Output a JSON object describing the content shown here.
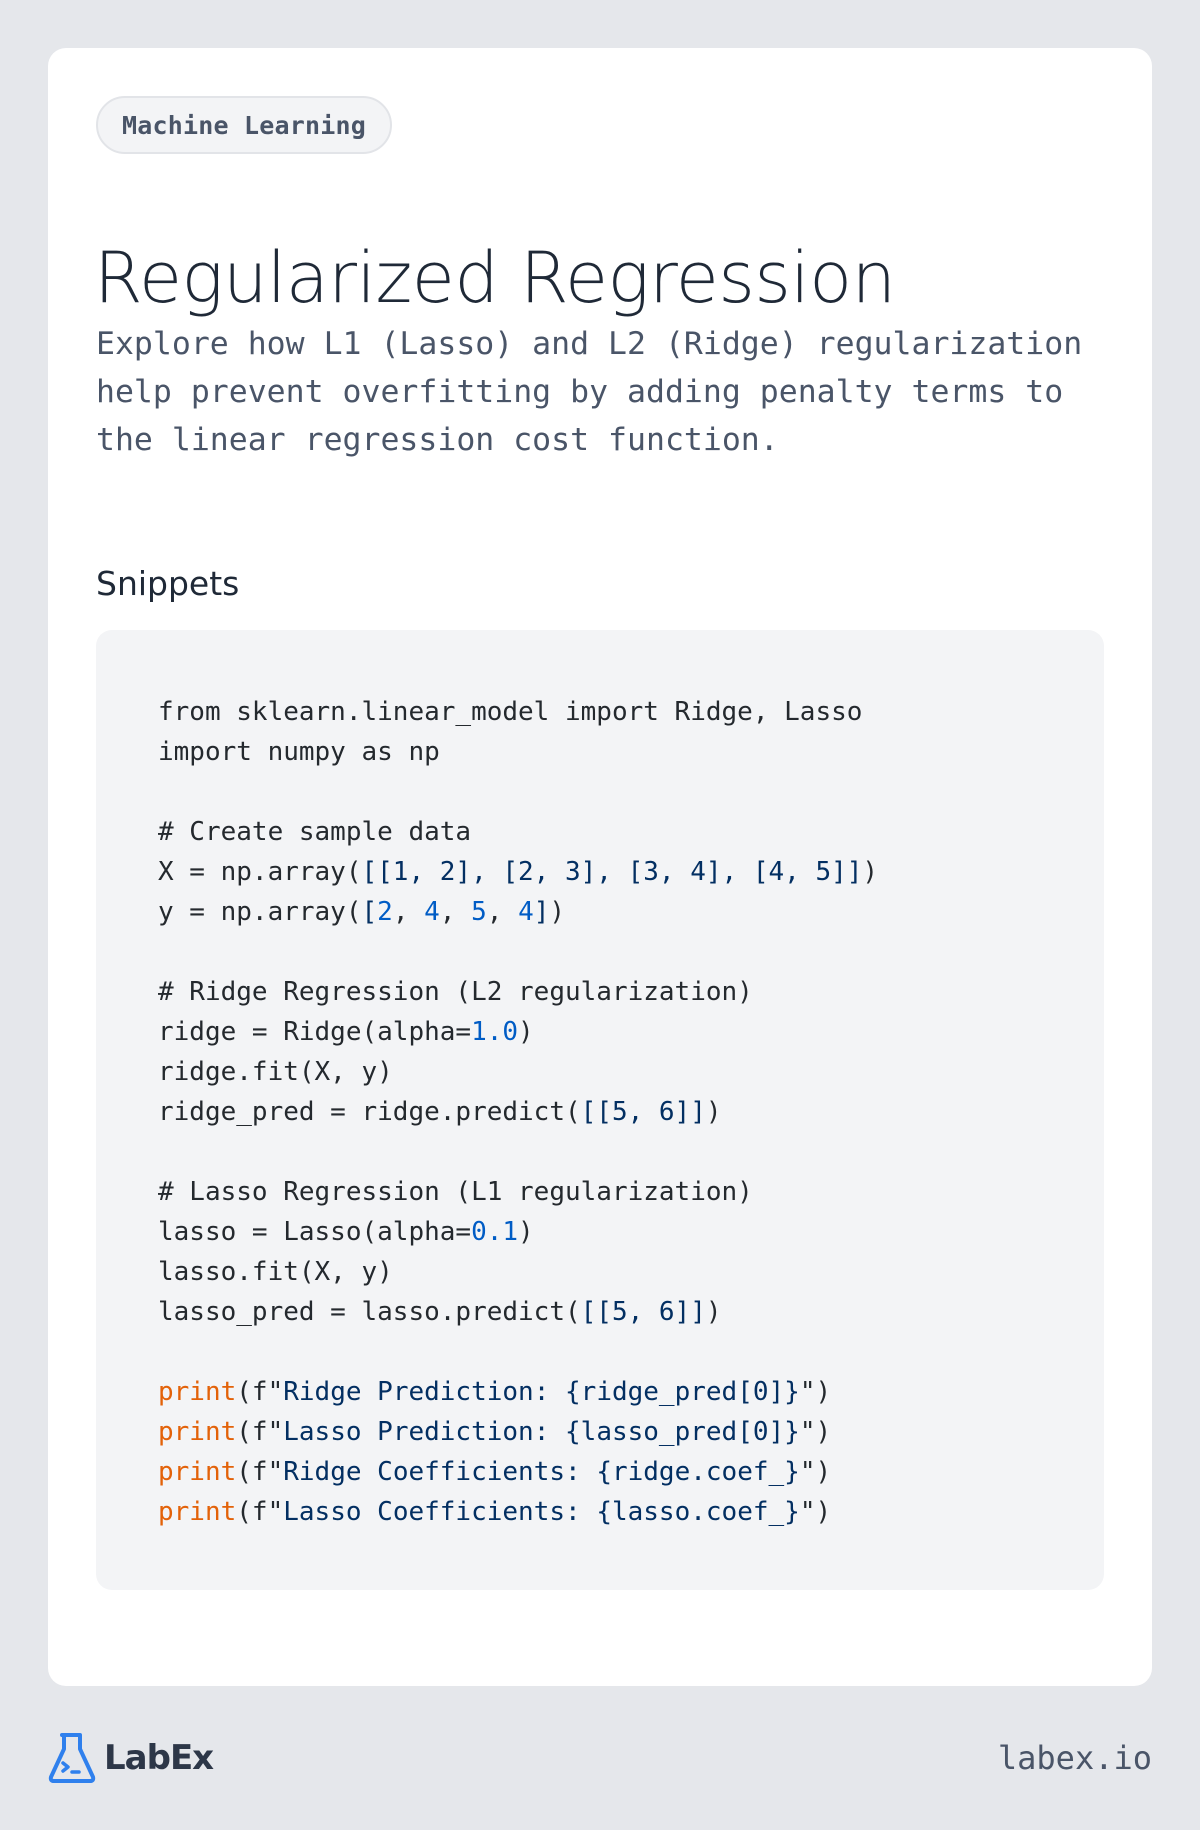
{
  "badge": {
    "label": "Machine Learning"
  },
  "page": {
    "title": "Regularized Regression",
    "description": "Explore how L1 (Lasso) and L2 (Ridge) regularization help prevent overfitting by adding penalty terms to the linear regression cost function."
  },
  "snippets": {
    "heading": "Snippets",
    "language": "python",
    "lines": [
      [
        {
          "t": "from sklearn.linear_model import Ridge, Lasso",
          "c": "plain"
        }
      ],
      [
        {
          "t": "import numpy as np",
          "c": "plain"
        }
      ],
      [],
      [
        {
          "t": "# Create sample data",
          "c": "plain"
        }
      ],
      [
        {
          "t": "X = np.array(",
          "c": "plain"
        },
        {
          "t": "[[1, 2], [2, 3], [3, 4], [4, 5]]",
          "c": "navy"
        },
        {
          "t": ")",
          "c": "plain"
        }
      ],
      [
        {
          "t": "y = np.array(",
          "c": "plain"
        },
        {
          "t": "[",
          "c": "navy"
        },
        {
          "t": "2",
          "c": "num"
        },
        {
          "t": ", ",
          "c": "plain"
        },
        {
          "t": "4",
          "c": "num"
        },
        {
          "t": ", ",
          "c": "plain"
        },
        {
          "t": "5",
          "c": "num"
        },
        {
          "t": ", ",
          "c": "plain"
        },
        {
          "t": "4",
          "c": "num"
        },
        {
          "t": "]",
          "c": "navy"
        },
        {
          "t": ")",
          "c": "plain"
        }
      ],
      [],
      [
        {
          "t": "# Ridge Regression (L2 regularization)",
          "c": "plain"
        }
      ],
      [
        {
          "t": "ridge = Ridge(alpha=",
          "c": "plain"
        },
        {
          "t": "1.0",
          "c": "num"
        },
        {
          "t": ")",
          "c": "plain"
        }
      ],
      [
        {
          "t": "ridge.fit(X, y)",
          "c": "plain"
        }
      ],
      [
        {
          "t": "ridge_pred = ridge.predict(",
          "c": "plain"
        },
        {
          "t": "[[5, 6]]",
          "c": "navy"
        },
        {
          "t": ")",
          "c": "plain"
        }
      ],
      [],
      [
        {
          "t": "# Lasso Regression (L1 regularization)",
          "c": "plain"
        }
      ],
      [
        {
          "t": "lasso = Lasso(alpha=",
          "c": "plain"
        },
        {
          "t": "0.1",
          "c": "num"
        },
        {
          "t": ")",
          "c": "plain"
        }
      ],
      [
        {
          "t": "lasso.fit(X, y)",
          "c": "plain"
        }
      ],
      [
        {
          "t": "lasso_pred = lasso.predict(",
          "c": "plain"
        },
        {
          "t": "[[5, 6]]",
          "c": "navy"
        },
        {
          "t": ")",
          "c": "plain"
        }
      ],
      [],
      [
        {
          "t": "print",
          "c": "fn"
        },
        {
          "t": "(f\"",
          "c": "plain"
        },
        {
          "t": "Ridge Prediction: {ridge_pred[0]}",
          "c": "navy"
        },
        {
          "t": "\")",
          "c": "plain"
        }
      ],
      [
        {
          "t": "print",
          "c": "fn"
        },
        {
          "t": "(f\"",
          "c": "plain"
        },
        {
          "t": "Lasso Prediction: {lasso_pred[0]}",
          "c": "navy"
        },
        {
          "t": "\")",
          "c": "plain"
        }
      ],
      [
        {
          "t": "print",
          "c": "fn"
        },
        {
          "t": "(f\"",
          "c": "plain"
        },
        {
          "t": "Ridge Coefficients: {ridge.coef_}",
          "c": "navy"
        },
        {
          "t": "\")",
          "c": "plain"
        }
      ],
      [
        {
          "t": "print",
          "c": "fn"
        },
        {
          "t": "(f\"",
          "c": "plain"
        },
        {
          "t": "Lasso Coefficients: {lasso.coef_}",
          "c": "navy"
        },
        {
          "t": "\")",
          "c": "plain"
        }
      ]
    ]
  },
  "footer": {
    "brand": "LabEx",
    "logo_icon": "flask-terminal-icon",
    "url": "labex.io"
  },
  "colors": {
    "background": "#e5e7eb",
    "card": "#ffffff",
    "code_background": "#f3f4f6",
    "brand_blue": "#2f80ed",
    "syntax_string": "#032f62",
    "syntax_number": "#005cc5",
    "syntax_builtin": "#e36209",
    "syntax_plain": "#24292e"
  }
}
